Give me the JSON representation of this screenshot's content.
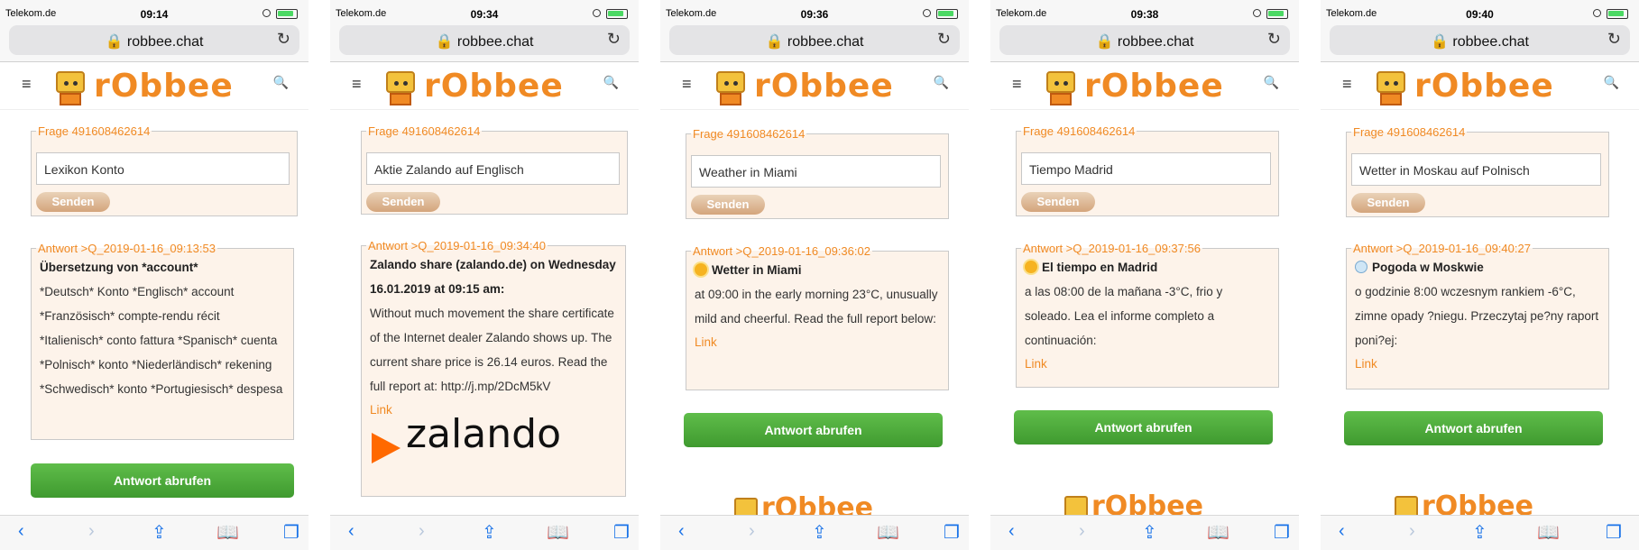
{
  "common": {
    "carrier": "Telekom.de",
    "host": "robbee.chat",
    "brand": "rObbee",
    "send_label": "Senden",
    "fetch_label": "Antwort abrufen",
    "link_label": "Link",
    "colors": {
      "accent": "#f08a24",
      "button_green": "#4caf3b",
      "panel_bg": "#fdf3ea"
    }
  },
  "phones": [
    {
      "time": "09:14",
      "question_legend": "Frage 491608462614",
      "question_value": "Lexikon Konto",
      "answer_legend": "Antwort >Q_2019-01-16_09:13:53",
      "answer_title": "Übersetzung von *account*",
      "answer_text": "*Deutsch* Konto *Englisch* account *Französisch* compte-rendu récit *Italienisch* conto fattura *Spanisch* cuenta *Polnisch* konto *Niederländisch* rekening *Schwedisch* konto *Portugiesisch* despesa"
    },
    {
      "time": "09:34",
      "question_legend": "Frage 491608462614",
      "question_value": "Aktie Zalando auf Englisch",
      "answer_legend": "Antwort >Q_2019-01-16_09:34:40",
      "answer_title": "Zalando share (zalando.de) on Wednesday 16.01.2019 at 09:15 am:",
      "answer_text": "Without much movement the share certificate of the Internet dealer Zalando shows up. The current share price is 26.14 euros. Read the full report at: http://j.mp/2DcM5kV",
      "logo_text": "zalando"
    },
    {
      "time": "09:36",
      "question_legend": "Frage 491608462614",
      "question_value": "Weather in Miami",
      "answer_legend": "Antwort >Q_2019-01-16_09:36:02",
      "answer_title": "Wetter in Miami",
      "answer_text": "at 09:00 in the early morning 23°C, unusually mild and cheerful. Read the full report below:"
    },
    {
      "time": "09:38",
      "question_legend": "Frage 491608462614",
      "question_value": "Tiempo Madrid",
      "answer_legend": "Antwort >Q_2019-01-16_09:37:56",
      "answer_title": "El tiempo en Madrid",
      "answer_text": "a las 08:00 de la mañana -3°C, frio y soleado. Lea el informe completo a continuación:"
    },
    {
      "time": "09:40",
      "question_legend": "Frage 491608462614",
      "question_value": "Wetter in Moskau auf Polnisch",
      "answer_legend": "Antwort >Q_2019-01-16_09:40:27",
      "answer_title": "Pogoda w Moskwie",
      "answer_text": "o godzinie 8:00 wczesnym rankiem -6°C, zimne opady ?niegu. Przeczytaj pe?ny raport poni?ej:"
    }
  ]
}
